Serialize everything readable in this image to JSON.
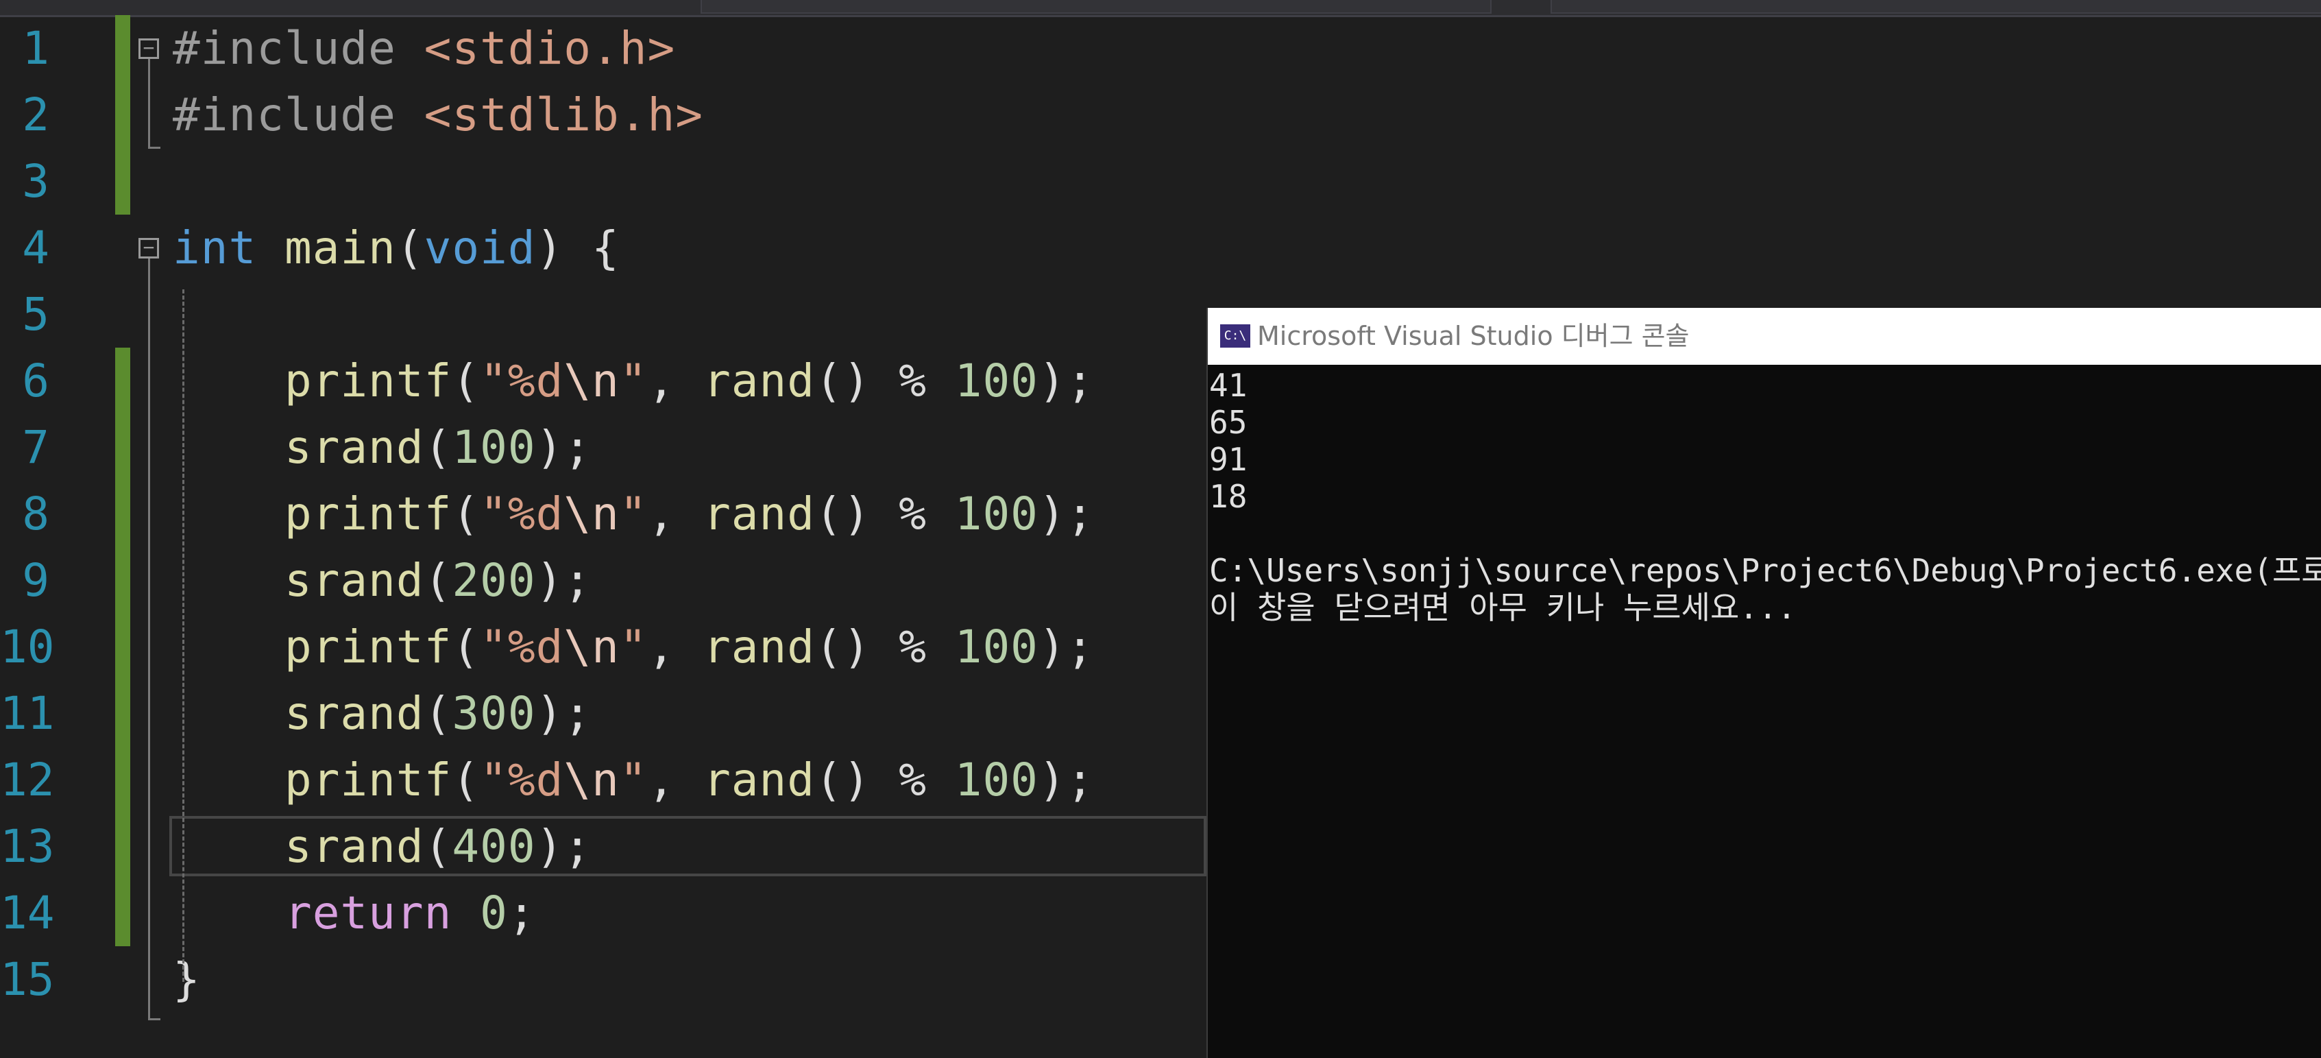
{
  "editor": {
    "lines": [
      {
        "no": "1",
        "tokens": [
          {
            "t": "#include ",
            "c": "pre"
          },
          {
            "t": "<stdio.h>",
            "c": "inc"
          }
        ]
      },
      {
        "no": "2",
        "tokens": [
          {
            "t": "#include ",
            "c": "pre"
          },
          {
            "t": "<stdlib.h>",
            "c": "inc"
          }
        ]
      },
      {
        "no": "3",
        "tokens": []
      },
      {
        "no": "4",
        "tokens": [
          {
            "t": "int",
            "c": "kw"
          },
          {
            "t": " ",
            "c": ""
          },
          {
            "t": "main",
            "c": "fn"
          },
          {
            "t": "(",
            "c": ""
          },
          {
            "t": "void",
            "c": "kw"
          },
          {
            "t": ") {",
            "c": ""
          }
        ]
      },
      {
        "no": "5",
        "tokens": []
      },
      {
        "no": "6",
        "tokens": [
          {
            "t": "    ",
            "c": ""
          },
          {
            "t": "printf",
            "c": "fn"
          },
          {
            "t": "(",
            "c": ""
          },
          {
            "t": "\"%d",
            "c": "str"
          },
          {
            "t": "\\n",
            "c": "esc"
          },
          {
            "t": "\"",
            "c": "str"
          },
          {
            "t": ", ",
            "c": ""
          },
          {
            "t": "rand",
            "c": "fn"
          },
          {
            "t": "() % ",
            "c": ""
          },
          {
            "t": "100",
            "c": "num"
          },
          {
            "t": ");",
            "c": ""
          }
        ]
      },
      {
        "no": "7",
        "tokens": [
          {
            "t": "    ",
            "c": ""
          },
          {
            "t": "srand",
            "c": "fn"
          },
          {
            "t": "(",
            "c": ""
          },
          {
            "t": "100",
            "c": "num"
          },
          {
            "t": ");",
            "c": ""
          }
        ]
      },
      {
        "no": "8",
        "tokens": [
          {
            "t": "    ",
            "c": ""
          },
          {
            "t": "printf",
            "c": "fn"
          },
          {
            "t": "(",
            "c": ""
          },
          {
            "t": "\"%d",
            "c": "str"
          },
          {
            "t": "\\n",
            "c": "esc"
          },
          {
            "t": "\"",
            "c": "str"
          },
          {
            "t": ", ",
            "c": ""
          },
          {
            "t": "rand",
            "c": "fn"
          },
          {
            "t": "() % ",
            "c": ""
          },
          {
            "t": "100",
            "c": "num"
          },
          {
            "t": ");",
            "c": ""
          }
        ]
      },
      {
        "no": "9",
        "tokens": [
          {
            "t": "    ",
            "c": ""
          },
          {
            "t": "srand",
            "c": "fn"
          },
          {
            "t": "(",
            "c": ""
          },
          {
            "t": "200",
            "c": "num"
          },
          {
            "t": ");",
            "c": ""
          }
        ]
      },
      {
        "no": "10",
        "tokens": [
          {
            "t": "    ",
            "c": ""
          },
          {
            "t": "printf",
            "c": "fn"
          },
          {
            "t": "(",
            "c": ""
          },
          {
            "t": "\"%d",
            "c": "str"
          },
          {
            "t": "\\n",
            "c": "esc"
          },
          {
            "t": "\"",
            "c": "str"
          },
          {
            "t": ", ",
            "c": ""
          },
          {
            "t": "rand",
            "c": "fn"
          },
          {
            "t": "() % ",
            "c": ""
          },
          {
            "t": "100",
            "c": "num"
          },
          {
            "t": ");",
            "c": ""
          }
        ]
      },
      {
        "no": "11",
        "tokens": [
          {
            "t": "    ",
            "c": ""
          },
          {
            "t": "srand",
            "c": "fn"
          },
          {
            "t": "(",
            "c": ""
          },
          {
            "t": "300",
            "c": "num"
          },
          {
            "t": ");",
            "c": ""
          }
        ]
      },
      {
        "no": "12",
        "tokens": [
          {
            "t": "    ",
            "c": ""
          },
          {
            "t": "printf",
            "c": "fn"
          },
          {
            "t": "(",
            "c": ""
          },
          {
            "t": "\"%d",
            "c": "str"
          },
          {
            "t": "\\n",
            "c": "esc"
          },
          {
            "t": "\"",
            "c": "str"
          },
          {
            "t": ", ",
            "c": ""
          },
          {
            "t": "rand",
            "c": "fn"
          },
          {
            "t": "() % ",
            "c": ""
          },
          {
            "t": "100",
            "c": "num"
          },
          {
            "t": ");",
            "c": ""
          }
        ]
      },
      {
        "no": "13",
        "tokens": [
          {
            "t": "    ",
            "c": ""
          },
          {
            "t": "srand",
            "c": "fn"
          },
          {
            "t": "(",
            "c": ""
          },
          {
            "t": "400",
            "c": "num"
          },
          {
            "t": ");",
            "c": ""
          }
        ]
      },
      {
        "no": "14",
        "tokens": [
          {
            "t": "    ",
            "c": ""
          },
          {
            "t": "return",
            "c": "ret"
          },
          {
            "t": " ",
            "c": ""
          },
          {
            "t": "0",
            "c": "num"
          },
          {
            "t": ";",
            "c": ""
          }
        ]
      },
      {
        "no": "15",
        "tokens": [
          {
            "t": "}",
            "c": ""
          }
        ]
      }
    ],
    "changed_lines": [
      "1",
      "2",
      "3",
      "6",
      "7",
      "8",
      "9",
      "10",
      "11",
      "12",
      "13",
      "14"
    ],
    "current_line": "13",
    "colors": {
      "background": "#1e1e1e",
      "line_number": "#2b91af",
      "keyword": "#569cd6",
      "function": "#dcdcaa",
      "string": "#d69d85",
      "number": "#b5cea8",
      "preprocessor": "#9b9b9b",
      "control_keyword": "#d8a0df",
      "change_marker": "#5b8c2e"
    }
  },
  "console": {
    "title": "Microsoft Visual Studio 디버그 콘솔",
    "icon_glyph": "C:\\",
    "output_lines": [
      "41",
      "65",
      "91",
      "18",
      "",
      "C:\\Users\\sonjj\\source\\repos\\Project6\\Debug\\Project6.exe(프로",
      "이 창을 닫으려면 아무 키나 누르세요..."
    ],
    "colors": {
      "background": "#0c0c0c",
      "title_bar": "#ffffff",
      "text": "#e0e0e0"
    }
  }
}
